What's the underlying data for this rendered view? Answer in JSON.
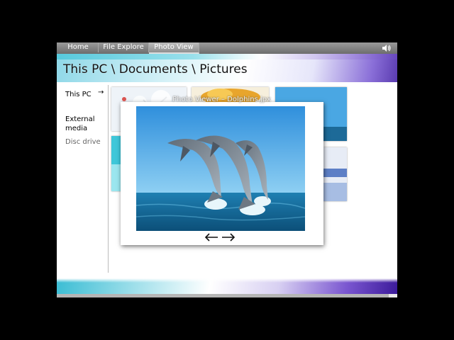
{
  "tabs": [
    {
      "label": "Home",
      "active": false
    },
    {
      "label": "File Explore",
      "active": false
    },
    {
      "label": "Photo View",
      "active": true
    }
  ],
  "breadcrumb": "This PC \\ Documents \\ Pictures",
  "sidebar": {
    "items": [
      {
        "label": "This PC",
        "selected": true
      },
      {
        "label": "External media",
        "selected": false
      },
      {
        "label": "Disc drive",
        "selected": false
      }
    ],
    "selected_arrow": "→"
  },
  "thumbnails": [
    {
      "name": "thumb-winter-tree",
      "colors": [
        "#dfe9f3",
        "#ffffff",
        "#9bb0c5"
      ]
    },
    {
      "name": "thumb-autumn-tree",
      "colors": [
        "#e7a72b",
        "#ffd36a",
        "#f4f0e4"
      ]
    },
    {
      "name": "thumb-dolphins-small",
      "colors": [
        "#6eb6e8",
        "#3a8fcf",
        "#1d5f93"
      ]
    },
    {
      "name": "thumb-teal-water",
      "colors": [
        "#37c5d8",
        "#8be3ee",
        "#d9f6fa"
      ]
    },
    {
      "name": "thumb-ice-sea",
      "colors": [
        "#e9eef7",
        "#9eb7dc",
        "#3d64b8"
      ]
    }
  ],
  "viewer": {
    "title": "Photo Viewer – Dolphins.jpx",
    "prev_label": "←",
    "next_label": "→"
  },
  "colors": {
    "sky": "#2f9be0",
    "sea": "#136a9a",
    "dolphin": "#7d8a96"
  }
}
